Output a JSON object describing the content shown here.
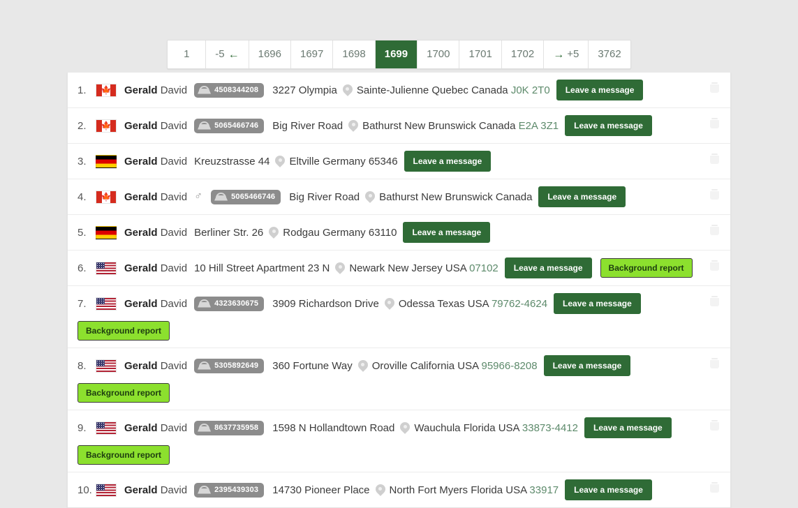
{
  "pagination": {
    "items": [
      {
        "label": "1",
        "type": "page",
        "active": false
      },
      {
        "label": "-5",
        "type": "jump-back",
        "arrow": "←",
        "active": false
      },
      {
        "label": "1696",
        "type": "page",
        "active": false
      },
      {
        "label": "1697",
        "type": "page",
        "active": false
      },
      {
        "label": "1698",
        "type": "page",
        "active": false
      },
      {
        "label": "1699",
        "type": "page",
        "active": true
      },
      {
        "label": "1700",
        "type": "page",
        "active": false
      },
      {
        "label": "1701",
        "type": "page",
        "active": false
      },
      {
        "label": "1702",
        "type": "page",
        "active": false
      },
      {
        "label": "+5",
        "type": "jump-forward",
        "arrow": "→",
        "active": false
      },
      {
        "label": "3762",
        "type": "page",
        "active": false
      }
    ],
    "current_page": "1699",
    "last_page": "3762",
    "accent_color": "#2f6b36"
  },
  "labels": {
    "leave_message": "Leave a message",
    "background_report": "Background report",
    "male_symbol": "♂",
    "delete_icon": "trash-icon"
  },
  "results": [
    {
      "index": "1.",
      "country": "ca",
      "first": "Gerald",
      "last": "David",
      "gender": "",
      "phone": "4508344208",
      "street": "3227 Olympia",
      "location": "Sainte-Julienne Quebec Canada",
      "zip": "J0K 2T0",
      "zip_green": true,
      "has_message": true,
      "has_report": false,
      "wrapped_report": false
    },
    {
      "index": "2.",
      "country": "ca",
      "first": "Gerald",
      "last": "David",
      "gender": "",
      "phone": "5065466746",
      "street": "Big River Road",
      "location": "Bathurst New Brunswick Canada",
      "zip": "E2A 3Z1",
      "zip_green": true,
      "has_message": true,
      "has_report": false,
      "wrapped_report": false
    },
    {
      "index": "3.",
      "country": "de",
      "first": "Gerald",
      "last": "David",
      "gender": "",
      "phone": "",
      "street": "Kreuzstrasse 44",
      "location": "Eltville Germany",
      "zip": "65346",
      "zip_green": false,
      "has_message": true,
      "has_report": false,
      "wrapped_report": false
    },
    {
      "index": "4.",
      "country": "ca",
      "first": "Gerald",
      "last": "David",
      "gender": "♂",
      "phone": "5065466746",
      "street": "Big River Road",
      "location": "Bathurst New Brunswick Canada",
      "zip": "",
      "zip_green": false,
      "has_message": true,
      "has_report": false,
      "wrapped_report": false
    },
    {
      "index": "5.",
      "country": "de",
      "first": "Gerald",
      "last": "David",
      "gender": "",
      "phone": "",
      "street": "Berliner Str. 26",
      "location": "Rodgau Germany",
      "zip": "63110",
      "zip_green": false,
      "has_message": true,
      "has_report": false,
      "wrapped_report": false
    },
    {
      "index": "6.",
      "country": "us",
      "first": "Gerald",
      "last": "David",
      "gender": "",
      "phone": "",
      "street": "10 Hill Street Apartment 23 N",
      "location": "Newark New Jersey USA",
      "zip": "07102",
      "zip_green": true,
      "has_message": true,
      "has_report": true,
      "wrapped_report": false
    },
    {
      "index": "7.",
      "country": "us",
      "first": "Gerald",
      "last": "David",
      "gender": "",
      "phone": "4323630675",
      "street": "3909 Richardson Drive",
      "location": "Odessa Texas USA",
      "zip": "79762-4624",
      "zip_green": true,
      "has_message": true,
      "has_report": true,
      "wrapped_report": true
    },
    {
      "index": "8.",
      "country": "us",
      "first": "Gerald",
      "last": "David",
      "gender": "",
      "phone": "5305892649",
      "street": "360 Fortune Way",
      "location": "Oroville California USA",
      "zip": "95966-8208",
      "zip_green": true,
      "has_message": true,
      "has_report": true,
      "wrapped_report": true
    },
    {
      "index": "9.",
      "country": "us",
      "first": "Gerald",
      "last": "David",
      "gender": "",
      "phone": "8637735958",
      "street": "1598 N Hollandtown Road",
      "location": "Wauchula Florida USA",
      "zip": "33873-4412",
      "zip_green": true,
      "has_message": true,
      "has_report": true,
      "wrapped_report": true
    },
    {
      "index": "10.",
      "country": "us",
      "first": "Gerald",
      "last": "David",
      "gender": "",
      "phone": "2395439303",
      "street": "14730 Pioneer Place",
      "location": "North Fort Myers Florida USA",
      "zip": "33917",
      "zip_green": true,
      "has_message": true,
      "has_report": false,
      "wrapped_report": false
    }
  ]
}
